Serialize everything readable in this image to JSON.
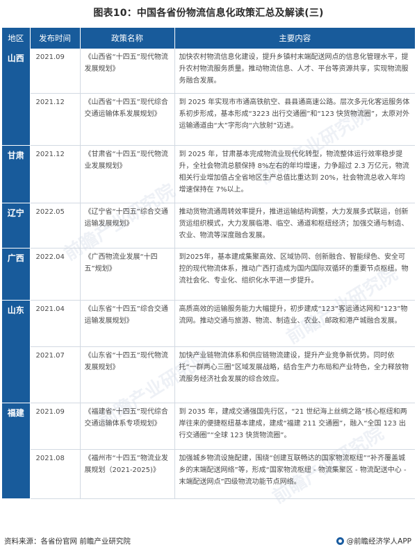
{
  "title": "图表10：中国各省份物流信息化政策汇总及解读(三)",
  "headers": [
    "地区",
    "发布时间",
    "政策名称",
    "主要内容"
  ],
  "regions": {
    "shanxi": "山西",
    "gansu": "甘肃",
    "liaoning": "辽宁",
    "guangxi": "广西",
    "shandong": "山东",
    "fujian": "福建"
  },
  "rows": [
    {
      "date": "2021.09",
      "policy": "《山西省“十四五”现代物流发展规划》",
      "content": "加快农村物流信息化建设，提升乡镇村末端配送网点的信息化管理水平，提升农村物流服务质量。推动物流信息、人才、平台等资源共享，实现物流服务融合发展。"
    },
    {
      "date": "2021.12",
      "policy": "《山西省“十四五”现代综合交通运输体系发展规划》",
      "content": "到 2025 年实现市市通高铁航空、县县通高速公路。层次多元化客运服务体系初步形成，基本形成“3223 出行交通圈”和“123 快货物流圈”，太原对外运输通道由“大”字形向“六放射”迈进。"
    },
    {
      "date": "2021.12",
      "policy": "《甘肃省“十四五”现代物流业发展规划》",
      "content": "到 2025 年，甘肃基本完成物流业现代化转型，物流整体运行效率稳步提升，全社会物流总额保持 8%左右的年均增速，力争超过 2.3 万亿元，物流相关行业增加值占全省地区生产总值比重达到 20%，社会物流总收入年均增速保持在 7%以上。"
    },
    {
      "date": "2022.05",
      "policy": "《辽宁省“十四五”综合交通运输发展规划》",
      "content": "推动货物流通周转效率提升，推进运输结构调整，大力发展多式联运，创新货运组织模式，大力发展临港、临空、通道和枢纽经济；加强交通与制造、农业、物流等深度融合发展。"
    },
    {
      "date": "2022.04",
      "policy": "《广西物流业发展“十四五”规划》",
      "content": "到2025年，基本建成集聚高效、区域协同、创新融合、智能绿色、安全可控的现代物流体系，推动广西打造成为国内国际双循环的重要节点枢纽。物流社会化、专业化、组织化水平进一步提升。"
    },
    {
      "date": "2021.04",
      "policy": "《山东省“十四五”综合交通运输发展规划》",
      "content": "高质高效的运输服务能力大幅提升，初步建成“123”客运通达网和“123”物流网。推动交通与旅游、物流、制造业、农业、邮政和港产城融合发展。"
    },
    {
      "date": "2021.07",
      "policy": "《山东省“十四五”现代物流发展规划》",
      "content": "加快产业链物流体系和供应链物流建设，提升产业竞争新优势。同时依托“一群两心三圈”区域发展战略，结合生产力布局和产业特色，全力释放物流服务经济社会发展的综合效应。"
    },
    {
      "date": "2021.09",
      "policy": "《福建省“十四五”现代综合交通运输体系专项规划》",
      "content": "到 2035 年，建成交通强国先行区，“21 世纪海上丝绸之路”核心枢纽和两岸往来的便捷枢纽基本建成，建成“福建 211 交通圈”，融入“全国 123 出行交通圈”“全球 123 快货物流圈”。"
    },
    {
      "date": "2021.08",
      "policy": "《福州市“十四五”物流业发展规划（2021-2025)》",
      "content": "加强城乡物流设施配建，围绕“创建互联畅达的国家物流枢纽”“补齐覆盖城乡的末端配送网络”等，形成“国家物流枢纽 - 物流集聚区 - 物流配送中心 - 末端配送网点”四级物流功能节点网络。"
    }
  ],
  "footer": {
    "source": "资料来源：各省份官网 前瞻产业研究院",
    "brand": "@前瞻经济学人APP"
  }
}
